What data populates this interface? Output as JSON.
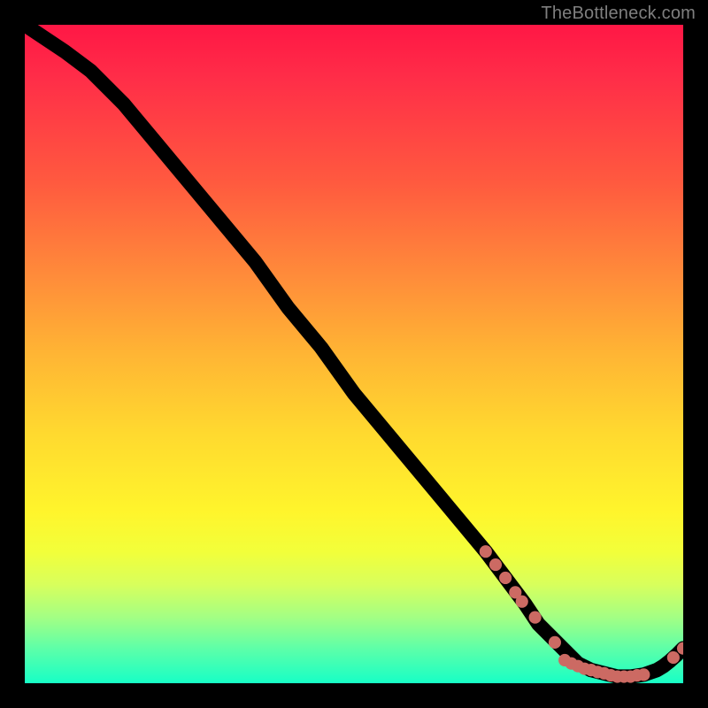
{
  "watermark": "TheBottleneck.com",
  "colors": {
    "background": "#000000",
    "curve": "#000000",
    "marker": "#cc6a63",
    "gradient_top": "#ff1745",
    "gradient_bottom": "#17ffc6",
    "watermark": "#7f7f7f"
  },
  "chart_data": {
    "type": "line",
    "title": "",
    "xlabel": "",
    "ylabel": "",
    "xlim": [
      0,
      100
    ],
    "ylim": [
      0,
      100
    ],
    "grid": false,
    "legend": false,
    "series": [
      {
        "name": "curve",
        "x": [
          0,
          3,
          6,
          10,
          15,
          20,
          25,
          30,
          35,
          40,
          45,
          50,
          55,
          60,
          65,
          70,
          73,
          76,
          78,
          80,
          82,
          84,
          86,
          88,
          90,
          92,
          94,
          96,
          97,
          98,
          99,
          100
        ],
        "y": [
          100,
          98,
          96,
          93,
          88,
          82,
          76,
          70,
          64,
          57,
          51,
          44,
          38,
          32,
          26,
          20,
          16,
          12,
          9,
          7,
          5,
          3,
          2,
          1.5,
          1,
          1,
          1.3,
          2,
          2.6,
          3.4,
          4.3,
          5.3
        ]
      }
    ],
    "markers": [
      {
        "x": 70.0,
        "y": 20.0
      },
      {
        "x": 71.5,
        "y": 18.0
      },
      {
        "x": 73.0,
        "y": 16.0
      },
      {
        "x": 74.5,
        "y": 13.8
      },
      {
        "x": 75.5,
        "y": 12.4
      },
      {
        "x": 77.5,
        "y": 10.0
      },
      {
        "x": 80.5,
        "y": 6.2
      },
      {
        "x": 82.0,
        "y": 3.5
      },
      {
        "x": 83.0,
        "y": 3.0
      },
      {
        "x": 84.0,
        "y": 2.6
      },
      {
        "x": 85.0,
        "y": 2.2
      },
      {
        "x": 86.0,
        "y": 2.0
      },
      {
        "x": 87.0,
        "y": 1.7
      },
      {
        "x": 88.0,
        "y": 1.5
      },
      {
        "x": 89.0,
        "y": 1.2
      },
      {
        "x": 90.0,
        "y": 1.0
      },
      {
        "x": 91.0,
        "y": 1.0
      },
      {
        "x": 92.0,
        "y": 1.0
      },
      {
        "x": 93.0,
        "y": 1.2
      },
      {
        "x": 94.0,
        "y": 1.3
      },
      {
        "x": 98.5,
        "y": 3.9
      },
      {
        "x": 100.0,
        "y": 5.3
      }
    ]
  }
}
